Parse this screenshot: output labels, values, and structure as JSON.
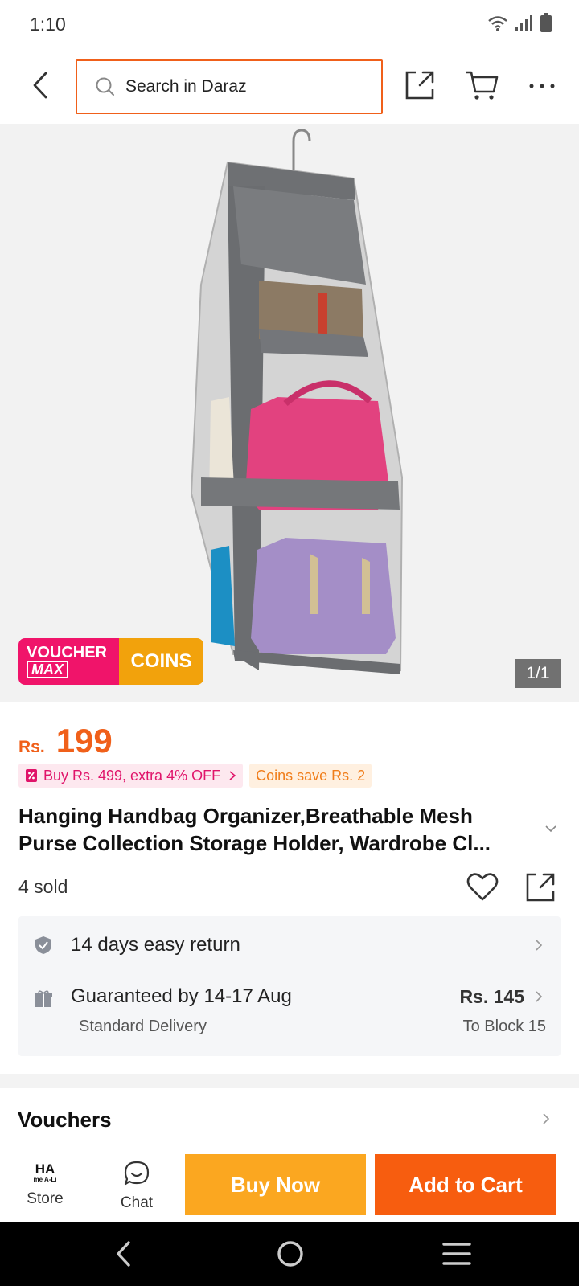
{
  "status": {
    "time": "1:10",
    "icons": [
      "wifi-icon",
      "signal-icon",
      "battery-icon"
    ]
  },
  "topnav": {
    "search_placeholder": "Search in Daraz",
    "icons": [
      "back-arrow-icon",
      "search-icon",
      "share-icon",
      "cart-icon",
      "more-icon"
    ]
  },
  "hero": {
    "voucher_badge_line1": "VOUCHER",
    "voucher_badge_line2": "MAX",
    "coins_badge": "COINS",
    "image_counter": "1/1"
  },
  "price": {
    "currency": "Rs.",
    "value": "199",
    "promo_bundle": "Buy Rs. 499, extra 4% OFF",
    "promo_coins": "Coins save Rs. 2"
  },
  "product": {
    "title": "Hanging Handbag Organizer,Breathable Mesh Purse Collection Storage Holder, Wardrobe Cl...",
    "sold": "4 sold"
  },
  "services": {
    "return_text": "14 days easy return",
    "delivery_text": "Guaranteed by 14-17 Aug",
    "delivery_sub": "Standard Delivery",
    "delivery_price": "Rs. 145",
    "delivery_dest": "To Block 15"
  },
  "vouchers": {
    "title": "Vouchers"
  },
  "action_bar": {
    "store_logo_line1": "HA",
    "store_logo_line2": "me A-Li",
    "store_label": "Store",
    "chat_label": "Chat",
    "buy_now": "Buy Now",
    "add_to_cart": "Add to Cart"
  },
  "colors": {
    "accent": "#f0601a",
    "buy_now": "#fba720",
    "add_to_cart": "#f75d0f",
    "voucher_pink": "#f0146a",
    "coins_gold": "#f2a20c"
  }
}
